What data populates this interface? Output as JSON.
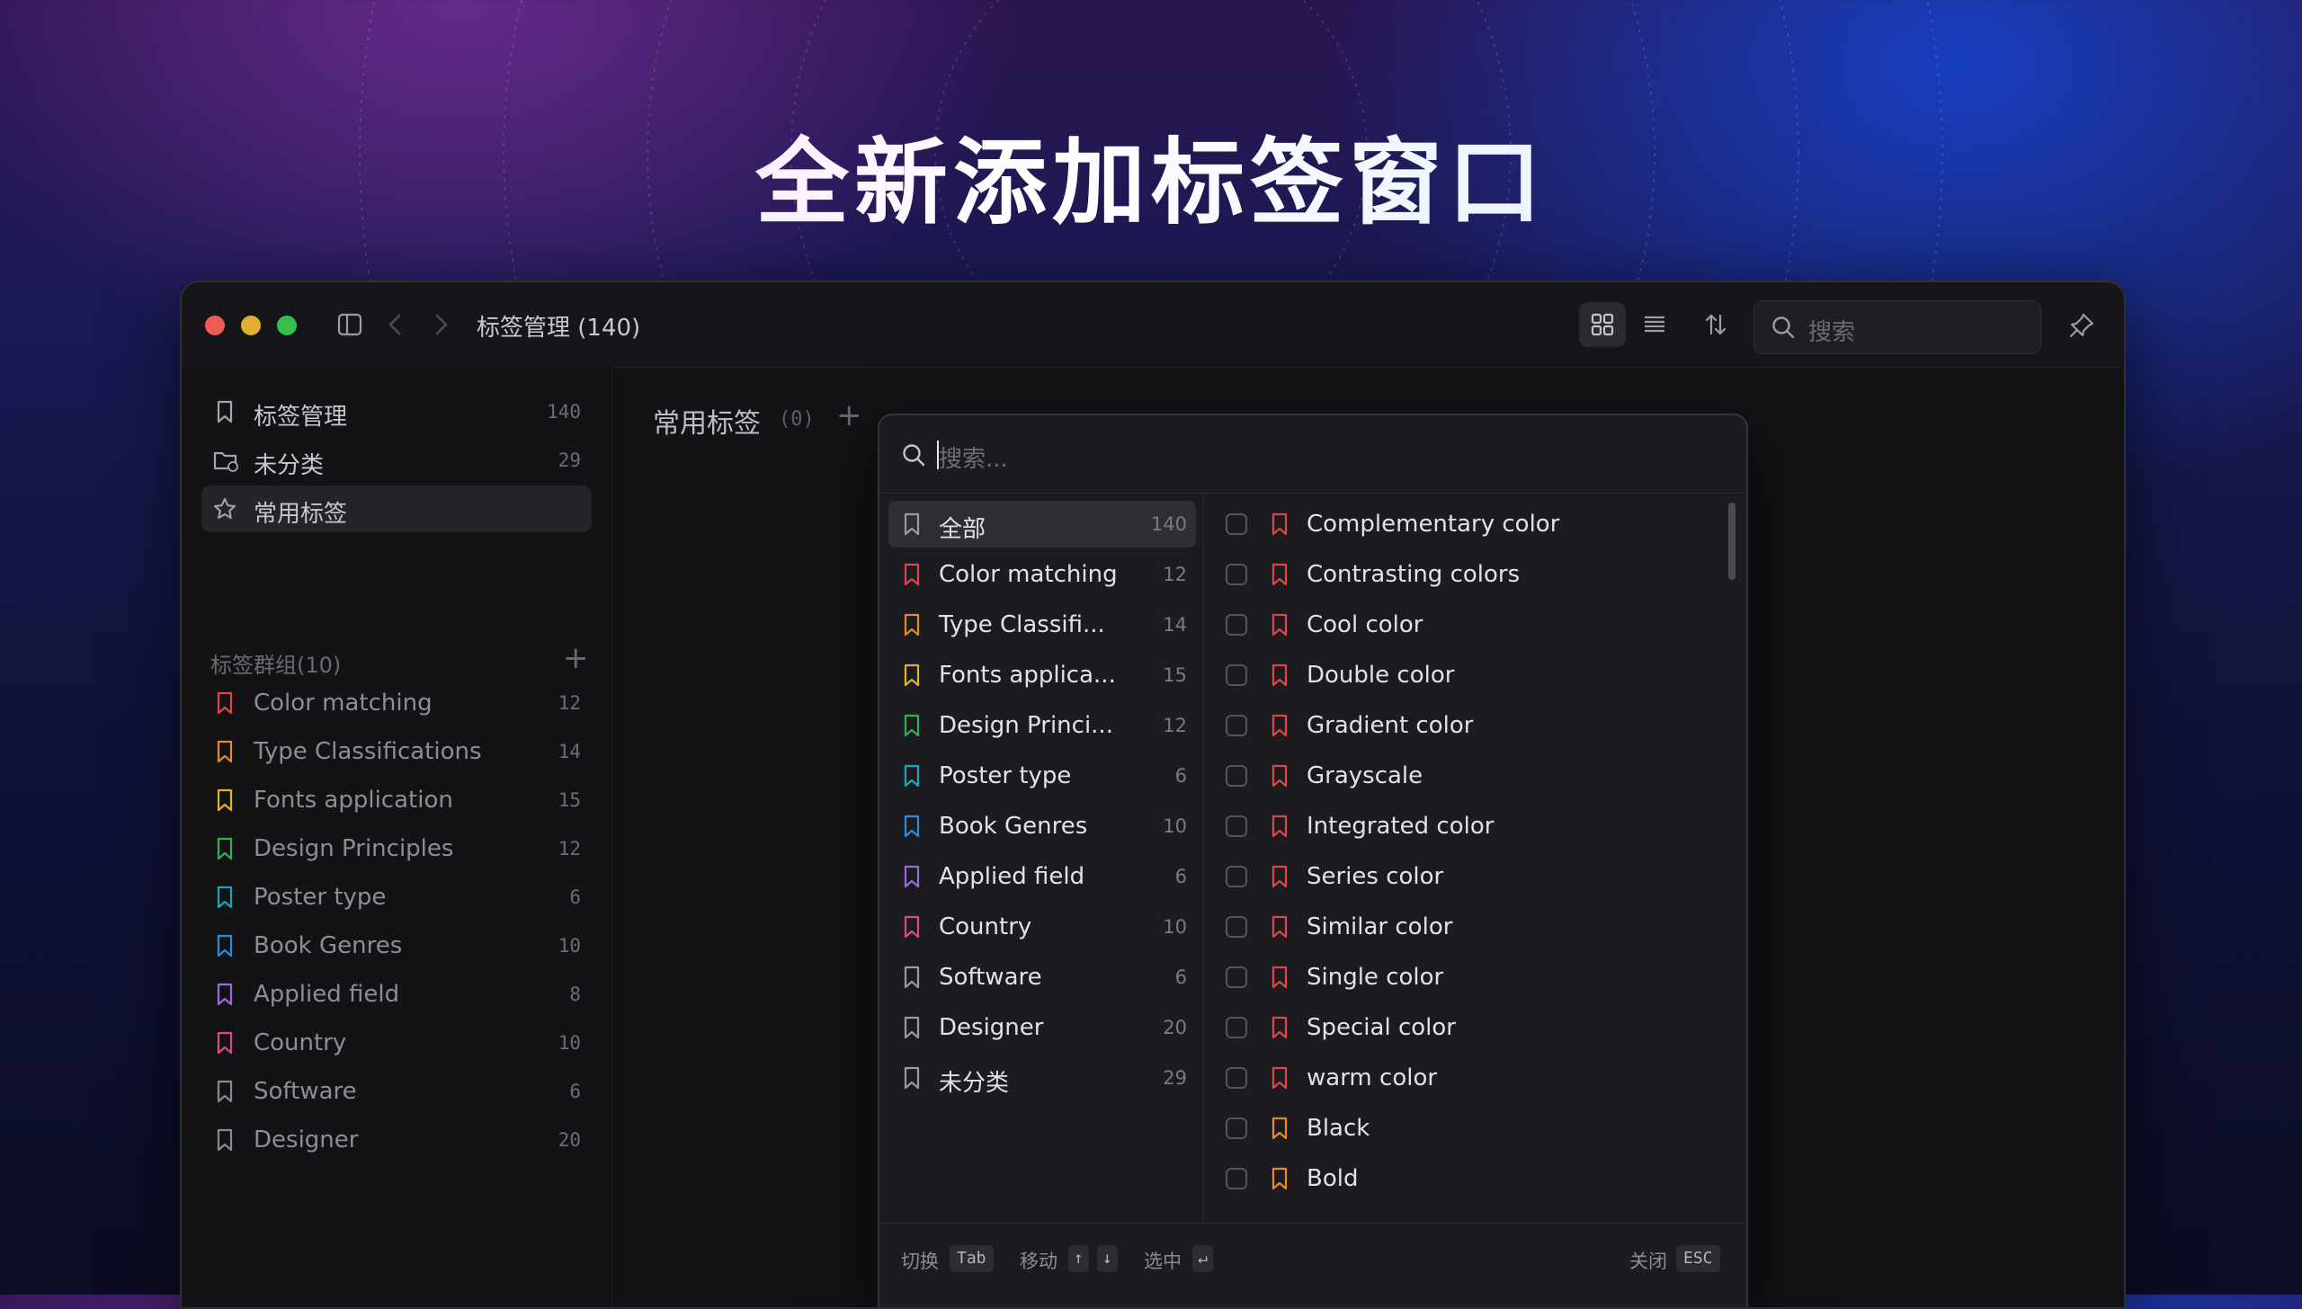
{
  "hero": {
    "title": "全新添加标签窗口"
  },
  "titlebar": {
    "breadcrumb": "标签管理 (140)",
    "search_placeholder": "搜索"
  },
  "sidebar": {
    "top_items": [
      {
        "label": "标签管理",
        "count": "140",
        "icon": "bookmark-icon"
      },
      {
        "label": "未分类",
        "count": "29",
        "icon": "folder-question-icon"
      },
      {
        "label": "常用标签",
        "count": "",
        "icon": "star-icon",
        "active": true
      }
    ],
    "group_title": "标签群组(10)",
    "groups": [
      {
        "label": "Color matching",
        "count": "12",
        "color": "#e0454b"
      },
      {
        "label": "Type Classifications",
        "count": "14",
        "color": "#e5892b"
      },
      {
        "label": "Fonts application",
        "count": "15",
        "color": "#e1b22a"
      },
      {
        "label": "Design Principles",
        "count": "12",
        "color": "#2fb15a"
      },
      {
        "label": "Poster type",
        "count": "6",
        "color": "#1fa7b8"
      },
      {
        "label": "Book Genres",
        "count": "10",
        "color": "#2a8de0"
      },
      {
        "label": "Applied field",
        "count": "8",
        "color": "#9a6be0"
      },
      {
        "label": "Country",
        "count": "10",
        "color": "#d94b8a"
      },
      {
        "label": "Software",
        "count": "6",
        "color": "#8a8a92"
      },
      {
        "label": "Designer",
        "count": "20",
        "color": "#8a8a92"
      }
    ]
  },
  "main": {
    "title": "常用标签",
    "count": "(0)"
  },
  "popup": {
    "search_placeholder": "搜索...",
    "left_items": [
      {
        "label": "全部",
        "count": "140",
        "color": "#9a9aa2",
        "active": true
      },
      {
        "label": "Color matching",
        "count": "12",
        "color": "#e0454b"
      },
      {
        "label": "Type Classifi...",
        "count": "14",
        "color": "#e5892b"
      },
      {
        "label": "Fonts applica...",
        "count": "15",
        "color": "#e1b22a"
      },
      {
        "label": "Design Princi...",
        "count": "12",
        "color": "#2fb15a"
      },
      {
        "label": "Poster type",
        "count": "6",
        "color": "#1fa7b8"
      },
      {
        "label": "Book Genres",
        "count": "10",
        "color": "#2a8de0"
      },
      {
        "label": "Applied field",
        "count": "6",
        "color": "#9a6be0"
      },
      {
        "label": "Country",
        "count": "10",
        "color": "#d94b8a"
      },
      {
        "label": "Software",
        "count": "6",
        "color": "#9a9aa2"
      },
      {
        "label": "Designer",
        "count": "20",
        "color": "#9a9aa2"
      },
      {
        "label": "未分类",
        "count": "29",
        "color": "#9a9aa2"
      }
    ],
    "right_items": [
      {
        "label": "Complementary color",
        "color": "#e0454b"
      },
      {
        "label": "Contrasting colors",
        "color": "#e0454b"
      },
      {
        "label": "Cool color",
        "color": "#e0454b"
      },
      {
        "label": "Double color",
        "color": "#e0454b"
      },
      {
        "label": "Gradient color",
        "color": "#e0454b"
      },
      {
        "label": "Grayscale",
        "color": "#e0454b"
      },
      {
        "label": "Integrated color",
        "color": "#e0454b"
      },
      {
        "label": "Series color",
        "color": "#e0454b"
      },
      {
        "label": "Similar color",
        "color": "#e0454b"
      },
      {
        "label": "Single color",
        "color": "#e0454b"
      },
      {
        "label": "Special color",
        "color": "#e0454b"
      },
      {
        "label": "warm color",
        "color": "#e0454b"
      },
      {
        "label": "Black",
        "color": "#e5892b"
      },
      {
        "label": "Bold",
        "color": "#e5892b"
      }
    ],
    "footer": {
      "switch_label": "切换",
      "switch_key": "Tab",
      "move_label": "移动",
      "move_key_up": "↑",
      "move_key_down": "↓",
      "select_label": "选中",
      "select_key": "↵",
      "close_label": "关闭",
      "close_key": "ESC"
    }
  }
}
